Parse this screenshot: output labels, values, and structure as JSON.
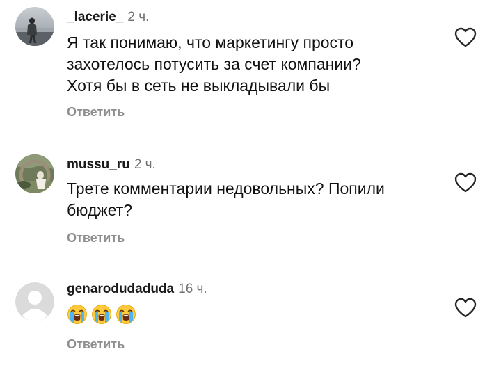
{
  "comments": [
    {
      "username": "_lacerie_",
      "time": "2 ч.",
      "lines": [
        "Я так понимаю, что маркетингу просто",
        "захотелось потусить за счет компании?",
        "Хотя бы в сеть не выкладывали бы"
      ],
      "reply_label": "Ответить",
      "icons": {
        "like": "heart-outline-icon"
      }
    },
    {
      "username": "mussu_ru",
      "time": "2 ч.",
      "lines": [
        "Трете комментарии недовольных? Попили",
        "бюджет?"
      ],
      "reply_label": "Ответить",
      "icons": {
        "like": "heart-outline-icon"
      }
    },
    {
      "username": "genarodudaduda",
      "time": "16 ч.",
      "emojis": [
        "😭",
        "😭",
        "😭"
      ],
      "reply_label": "Ответить",
      "icons": {
        "like": "heart-outline-icon",
        "avatar": "default-avatar-icon"
      }
    }
  ],
  "colors": {
    "text": "#111111",
    "secondary": "#737373",
    "reply": "#8e8e8e",
    "avatar_placeholder_bg": "#dbdbdb",
    "avatar_placeholder_fg": "#ffffff"
  }
}
